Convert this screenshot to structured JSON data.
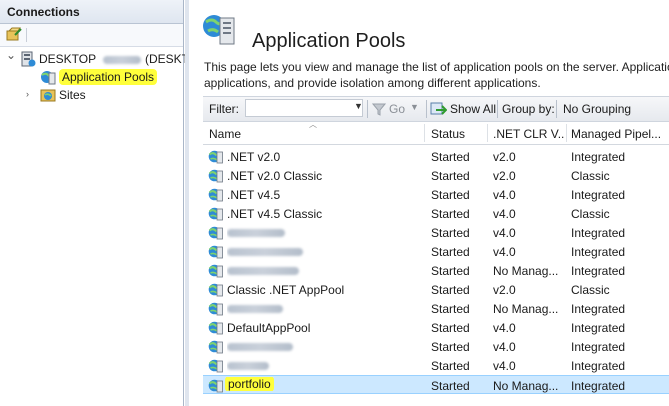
{
  "connections": {
    "title": "Connections",
    "tree": [
      {
        "label": "DESKTOP",
        "suffix": "(DESKT",
        "level": 0,
        "expanded": true
      },
      {
        "label": "Application Pools",
        "level": 1,
        "highlighted": true
      },
      {
        "label": "Sites",
        "level": 1,
        "expanded": false
      }
    ]
  },
  "main": {
    "title": "Application Pools",
    "description_line1": "This page lets you view and manage the list of application pools on the server. Applicatio",
    "description_line2": "applications, and provide isolation among different applications."
  },
  "filter_bar": {
    "filter_label": "Filter:",
    "filter_value": "",
    "go_label": "Go",
    "show_all_label": "Show All",
    "group_by_label": "Group by:",
    "group_by_value": "No Grouping"
  },
  "grid": {
    "columns": [
      "Name",
      "Status",
      ".NET CLR V...",
      "Managed Pipel..."
    ],
    "rows": [
      {
        "name": ".NET v2.0",
        "status": "Started",
        "clr": "v2.0",
        "pipeline": "Integrated"
      },
      {
        "name": ".NET v2.0 Classic",
        "status": "Started",
        "clr": "v2.0",
        "pipeline": "Classic"
      },
      {
        "name": ".NET v4.5",
        "status": "Started",
        "clr": "v4.0",
        "pipeline": "Integrated"
      },
      {
        "name": ".NET v4.5 Classic",
        "status": "Started",
        "clr": "v4.0",
        "pipeline": "Classic"
      },
      {
        "name": "",
        "status": "Started",
        "clr": "v4.0",
        "pipeline": "Integrated",
        "redacted": true
      },
      {
        "name": "",
        "status": "Started",
        "clr": "v4.0",
        "pipeline": "Integrated",
        "redacted": true
      },
      {
        "name": "",
        "status": "Started",
        "clr": "No Manag...",
        "pipeline": "Integrated",
        "redacted": true
      },
      {
        "name": "Classic .NET AppPool",
        "status": "Started",
        "clr": "v2.0",
        "pipeline": "Classic"
      },
      {
        "name": "",
        "status": "Started",
        "clr": "No Manag...",
        "pipeline": "Integrated",
        "redacted": true
      },
      {
        "name": "DefaultAppPool",
        "status": "Started",
        "clr": "v4.0",
        "pipeline": "Integrated"
      },
      {
        "name": "",
        "status": "Started",
        "clr": "v4.0",
        "pipeline": "Integrated",
        "redacted": true
      },
      {
        "name": "",
        "status": "Started",
        "clr": "v4.0",
        "pipeline": "Integrated",
        "redacted": true
      },
      {
        "name": "portfolio",
        "status": "Started",
        "clr": "No Manag...",
        "pipeline": "Integrated",
        "selected": true
      }
    ]
  },
  "colors": {
    "highlight": "#ffff3b",
    "selection": "#cce8ff",
    "selection_border": "#99d1ff"
  }
}
